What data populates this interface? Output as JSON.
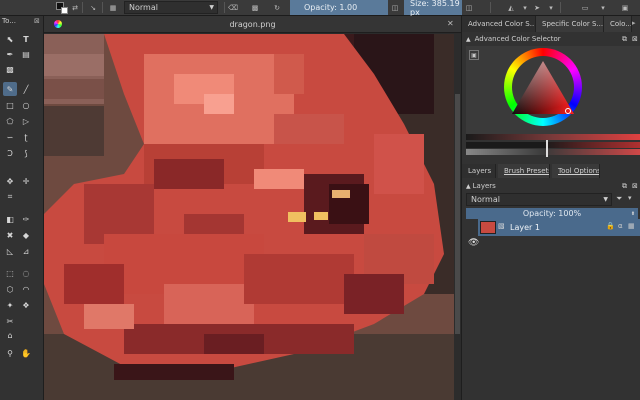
{
  "toolbar": {
    "blend_mode": "Normal",
    "opacity_label": "Opacity:  1.00",
    "size_label": "Size:  385.19 px"
  },
  "toolbox": {
    "title": "To..."
  },
  "document": {
    "tab_title": "dragon.png"
  },
  "docker": {
    "tabs": [
      "Advanced Color S...",
      "Specific Color S...",
      "Colo..."
    ],
    "color_selector_title": "Advanced Color Selector",
    "lower_tabs": [
      "Layers",
      "Brush Presets",
      "Tool Options"
    ],
    "layers_title": "Layers",
    "blend_mode": "Normal",
    "opacity_label": "Opacity:  100%",
    "layer_name": "Layer 1"
  },
  "colors": {
    "accent": "#4a6a8c",
    "panel": "#323232",
    "canvas_bg": "#6a4a3e"
  }
}
